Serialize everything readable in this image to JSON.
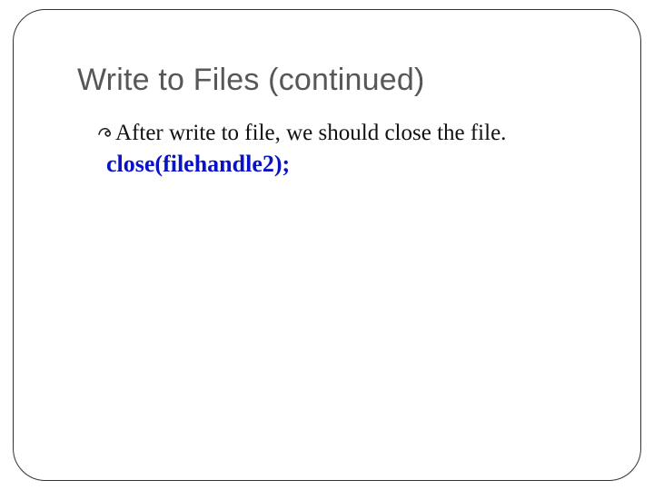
{
  "slide": {
    "title": "Write to Files (continued)",
    "bullets": [
      {
        "icon": "└",
        "text": "After write to file, we should close the file."
      }
    ],
    "code": "close(filehandle2);"
  }
}
